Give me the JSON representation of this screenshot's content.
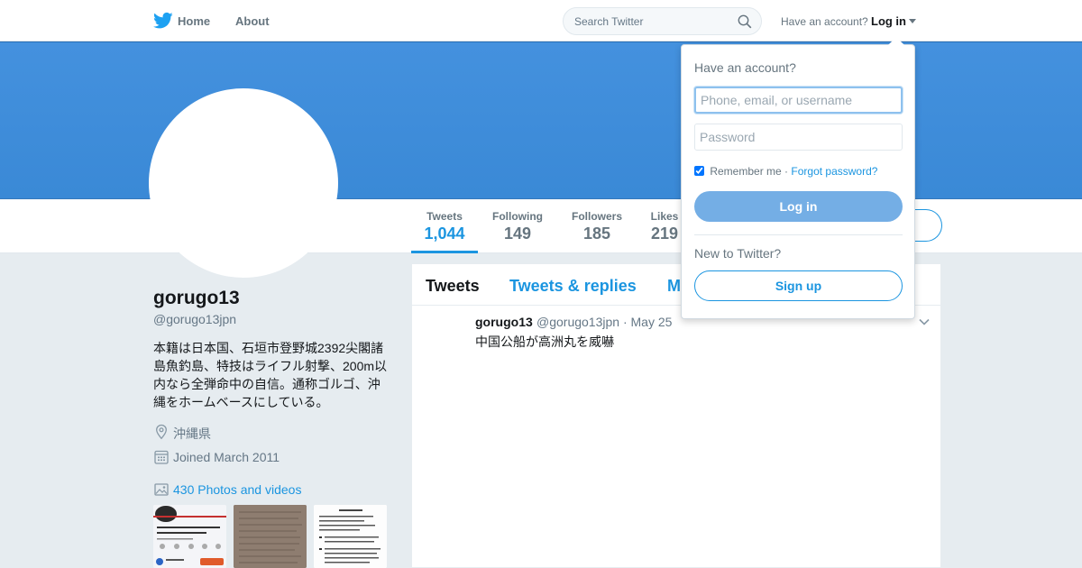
{
  "topnav": {
    "logo_icon": "twitter-bird-icon",
    "home_label": "Home",
    "about_label": "About",
    "search_placeholder": "Search Twitter",
    "search_icon": "search-icon",
    "have_account_text": "Have an account?",
    "login_label": "Log in"
  },
  "colors": {
    "brand_blue": "#1b95e0",
    "banner_blue": "#4491de",
    "page_bg": "#e6ecf0"
  },
  "profile": {
    "name": "gorugo13",
    "handle": "@gorugo13jpn",
    "bio": "本籍は日本国、石垣市登野城2392尖閣諸島魚釣島、特技はライフル射撃、200m以内なら全弾命中の自信。通称ゴルゴ、沖縄をホームベースにしている。",
    "location": "沖縄県",
    "joined": "Joined March 2011",
    "photos_link": "430 Photos and videos"
  },
  "stats": [
    {
      "label": "Tweets",
      "value": "1,044"
    },
    {
      "label": "Following",
      "value": "149"
    },
    {
      "label": "Followers",
      "value": "185"
    },
    {
      "label": "Likes",
      "value": "219"
    }
  ],
  "timeline": {
    "tabs": [
      "Tweets",
      "Tweets & replies",
      "M"
    ],
    "tweet": {
      "name": "gorugo13",
      "handle_date": "@gorugo13jpn · May 25",
      "text": "中国公船が高洲丸を威嚇"
    }
  },
  "login_dropdown": {
    "title": "Have an account?",
    "username_placeholder": "Phone, email, or username",
    "password_placeholder": "Password",
    "remember_label": "Remember me",
    "separator": "·",
    "forgot_label": "Forgot password?",
    "login_button": "Log in",
    "new_prompt": "New to Twitter?",
    "signup_button": "Sign up"
  }
}
